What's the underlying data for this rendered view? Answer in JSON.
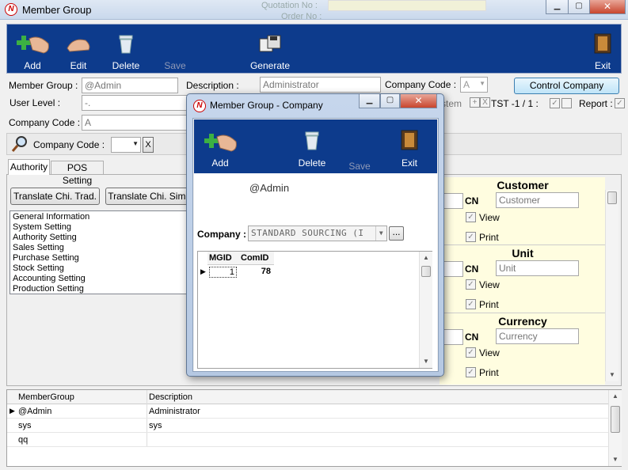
{
  "window": {
    "title": "Member Group"
  },
  "toolbar": {
    "add": "Add",
    "edit": "Edit",
    "delete": "Delete",
    "save": "Save",
    "generate": "Generate",
    "exit": "Exit"
  },
  "form": {
    "member_group_label": "Member Group :",
    "member_group_value": "@Admin",
    "description_label": "Description :",
    "description_value": "Administrator",
    "company_code_label": "Company Code :",
    "company_code_value": "A",
    "control_company_button": "Control Company",
    "user_level_label": "User Level :",
    "user_level_value": "-.",
    "company_code2_label": "Company Code :",
    "company_code2_value": "A",
    "stem_text": "stem",
    "plus_text": "+",
    "x_text": "X",
    "tst_text": "TST -1 / 1 :",
    "report_label": "Report :"
  },
  "filter": {
    "company_code_label": "Company Code :",
    "clear_button": "X"
  },
  "tabs": [
    {
      "label": "Authority"
    },
    {
      "label": "POS Setting"
    }
  ],
  "translate_trad_button": "Translate Chi. Trad.",
  "translate_sim_button": "Translate Chi. Sim.",
  "authority_list": [
    "General Information",
    "System Setting",
    "Authority Setting",
    "Sales Setting",
    "Purchase Setting",
    "Stock Setting",
    "Accounting Setting",
    "Production Setting"
  ],
  "sections": [
    {
      "title": "Customer",
      "cn_label": "CN",
      "cn_value": "Customer",
      "view": "View",
      "print": "Print"
    },
    {
      "title": "Unit",
      "cn_label": "CN",
      "cn_value": "Unit",
      "view": "View",
      "print": "Print"
    },
    {
      "title": "Currency",
      "cn_label": "CN",
      "cn_value": "Currency",
      "view": "View",
      "print": "Print"
    }
  ],
  "grid": {
    "headers": [
      "MemberGroup",
      "Description"
    ],
    "rows": [
      [
        "@Admin",
        "Administrator"
      ],
      [
        "sys",
        "sys"
      ],
      [
        "qq",
        ""
      ]
    ]
  },
  "background_fields": {
    "quotation_label": "Quotation No :",
    "order_label": "Order No :"
  },
  "dialog": {
    "title": "Member Group - Company",
    "toolbar": {
      "add": "Add",
      "delete": "Delete",
      "save": "Save",
      "exit": "Exit"
    },
    "group_value": "@Admin",
    "company_label": "Company :",
    "company_value": "STANDARD SOURCING (I",
    "browse_button": "...",
    "grid_headers": [
      "MGID",
      "ComID"
    ],
    "grid_rows": [
      [
        "1",
        "78"
      ]
    ]
  },
  "colors": {
    "toolbar_bg": "#0d3b8c",
    "panel_yellow": "#fffde0",
    "close_red": "#c8452d"
  }
}
